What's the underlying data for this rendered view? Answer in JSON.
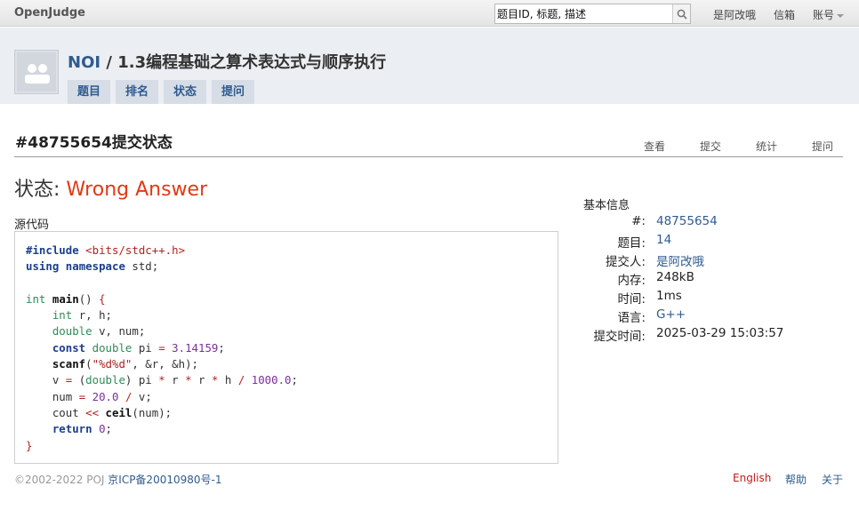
{
  "topbar": {
    "brand": "OpenJudge",
    "search_value": "题目ID, 标题, 描述",
    "user_name": "是阿改哦",
    "mailbox": "信箱",
    "account": "账号"
  },
  "header": {
    "group": "NOI",
    "separator": "/",
    "title": "1.3编程基础之算术表达式与顺序执行",
    "tabs": [
      "题目",
      "排名",
      "状态",
      "提问"
    ]
  },
  "submission": {
    "title": "#48755654提交状态",
    "actions": [
      "查看",
      "提交",
      "统计",
      "提问"
    ],
    "status_label": "状态:",
    "status_value": "Wrong Answer",
    "source_label": "源代码"
  },
  "code_lines": [
    "#include <bits/stdc++.h>",
    "using namespace std;",
    "",
    "int main() {",
    "    int r, h;",
    "    double v, num;",
    "    const double pi = 3.14159;",
    "    scanf(\"%d%d\", &r, &h);",
    "    v = (double) pi * r * r * h / 1000.0;",
    "    num = 20.0 / v;",
    "    cout << ceil(num);",
    "    return 0;",
    "}"
  ],
  "info": {
    "title": "基本信息",
    "rows": [
      {
        "key": "#:",
        "value": "48755654"
      },
      {
        "key": "题目:",
        "value": "14"
      },
      {
        "key": "提交人:",
        "value": "是阿改哦"
      },
      {
        "key": "内存:",
        "value": "248kB"
      },
      {
        "key": "时间:",
        "value": "1ms"
      },
      {
        "key": "语言:",
        "value": "G++"
      },
      {
        "key": "提交时间:",
        "value": "2025-03-29 15:03:57"
      }
    ]
  },
  "footer": {
    "copyright": "©2002-2022 POJ",
    "icp": "京ICP备20010980号-1",
    "links": [
      "English",
      "帮助",
      "关于"
    ]
  },
  "colors": {
    "status_error": "#e03a12",
    "link_blue": "#2f5b8f",
    "header_bg": "#ebeef2"
  }
}
